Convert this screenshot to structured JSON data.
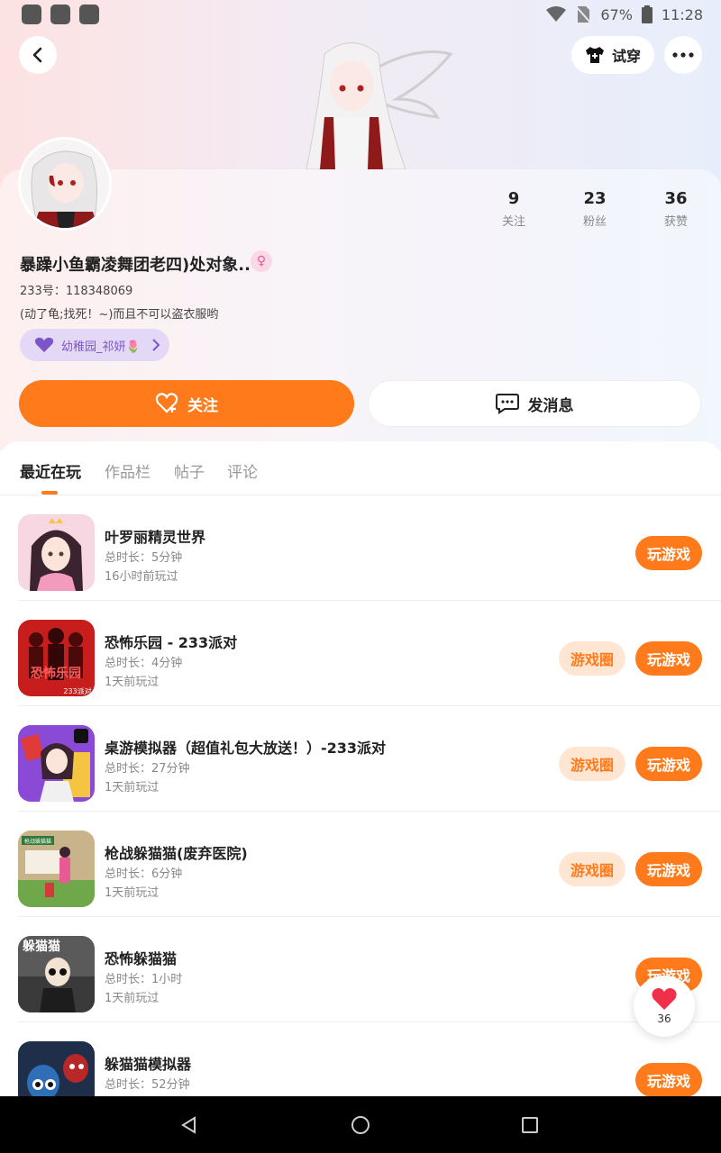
{
  "status_bar": {
    "battery": "67%",
    "time": "11:28",
    "icons": [
      "notification-icon",
      "notification-icon",
      "notification-icon",
      "wifi-icon",
      "no-sim-icon",
      "battery-icon"
    ]
  },
  "header": {
    "back_icon": "chevron-left-icon",
    "try_on_label": "试穿",
    "more_icon": "more-dots-icon"
  },
  "profile": {
    "username": "暴躁小鱼霸凌舞团老四)处对象..",
    "gender_symbol": "♀",
    "uid": "233号：118348069",
    "bio": "(动了龟;找死！~)而且不可以盗衣服哟",
    "family_label": "幼稚园_祁妍🌷",
    "stats": [
      {
        "num": "9",
        "label": "关注"
      },
      {
        "num": "23",
        "label": "粉丝"
      },
      {
        "num": "36",
        "label": "获赞"
      }
    ],
    "follow_label": "关注",
    "message_label": "发消息"
  },
  "tabs": [
    {
      "label": "最近在玩",
      "active": true
    },
    {
      "label": "作品栏",
      "active": false
    },
    {
      "label": "帖子",
      "active": false
    },
    {
      "label": "评论",
      "active": false
    }
  ],
  "games": [
    {
      "title": "叶罗丽精灵世界",
      "duration": "总时长：5分钟",
      "last_played": "16小时前玩过",
      "has_circle": false
    },
    {
      "title": "恐怖乐园 - 233派对",
      "duration": "总时长：4分钟",
      "last_played": "1天前玩过",
      "has_circle": true
    },
    {
      "title": "桌游模拟器（超值礼包大放送！）-233派对",
      "duration": "总时长：27分钟",
      "last_played": "1天前玩过",
      "has_circle": true
    },
    {
      "title": "枪战躲猫猫(废弃医院)",
      "duration": "总时长：6分钟",
      "last_played": "1天前玩过",
      "has_circle": true
    },
    {
      "title": "恐怖躲猫猫",
      "duration": "总时长：1小时",
      "last_played": "1天前玩过",
      "has_circle": false
    },
    {
      "title": "躲猫猫模拟器",
      "duration": "总时长：52分钟",
      "last_played": "",
      "has_circle": false
    }
  ],
  "game_buttons": {
    "play": "玩游戏",
    "circle": "游戏圈"
  },
  "game_icon_texts": {
    "horror_park": "恐怖乐园",
    "horror_park_badge": "233派对",
    "hide_seek": "躲猫猫",
    "hospital": "枪战躲猫猫"
  },
  "like_float": {
    "count": "36"
  },
  "colors": {
    "accent": "#ff7a1a",
    "accent_light": "#ffe6d3",
    "family_pill": "#e3d9f6"
  }
}
